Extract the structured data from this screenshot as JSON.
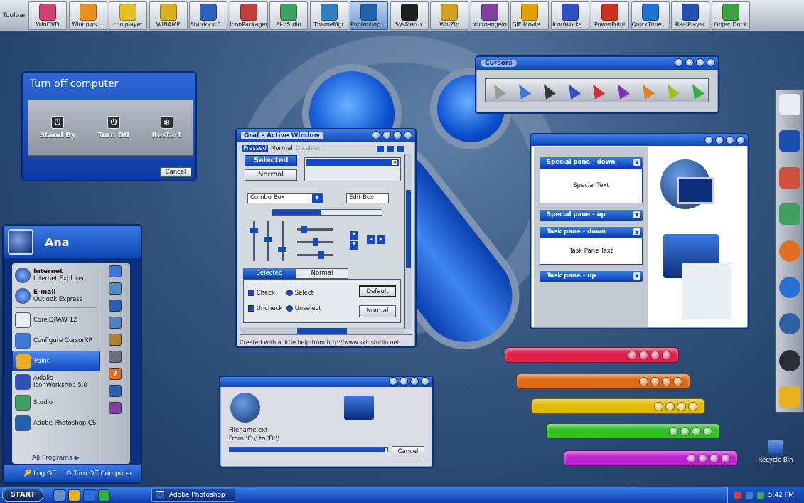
{
  "toolbar": {
    "label": "Toolbar",
    "items": [
      {
        "label": "WinDVD",
        "color": "#d04070"
      },
      {
        "label": "Windows ...",
        "color": "#e89020"
      },
      {
        "label": "coolplayer",
        "color": "#e8c020"
      },
      {
        "label": "WINAMP",
        "color": "#d8b020"
      },
      {
        "label": "Stardock C...",
        "color": "#3060c0"
      },
      {
        "label": "IconPackager",
        "color": "#c04040"
      },
      {
        "label": "SknStdio",
        "color": "#40a060"
      },
      {
        "label": "ThemeMgr",
        "color": "#3080c0"
      },
      {
        "label": "Photoshop ...",
        "color": "#2060b0"
      },
      {
        "label": "SysMetrix",
        "color": "#202020"
      },
      {
        "label": "WinZip",
        "color": "#d0a020"
      },
      {
        "label": "Microangelo",
        "color": "#8040a0"
      },
      {
        "label": "GIF Movie ...",
        "color": "#e0a000"
      },
      {
        "label": "IconWorks...",
        "color": "#3050c0"
      },
      {
        "label": "PowerPoint",
        "color": "#d03020"
      },
      {
        "label": "QuickTime ...",
        "color": "#2070d0"
      },
      {
        "label": "RealPlayer",
        "color": "#2050b0"
      },
      {
        "label": "ObjectDock",
        "color": "#40a040"
      }
    ],
    "active_index": 8
  },
  "turnoff": {
    "title": "Turn off computer",
    "standby": "Stand By",
    "turnoff": "Turn Off",
    "restart": "Restart",
    "cancel": "Cancel"
  },
  "startmenu": {
    "user": "Ana",
    "internet_title": "Internet",
    "internet_sub": "Internet Explorer",
    "email_title": "E-mail",
    "email_sub": "Outlook Express",
    "items": [
      "CorelDRAW 12",
      "Configure CursorXP",
      "Paint",
      "Axialis IconWorkshop 5.0",
      "Studio",
      "Adobe Photoshop CS"
    ],
    "all_programs": "All Programs",
    "log_off": "Log Off",
    "turn_off": "Turn Off Computer"
  },
  "graf": {
    "title": "Graf - Active Window",
    "tab_pressed": "Pressed",
    "tab_normal": "Normal",
    "tab_disabled": "Disabled",
    "btn_selected": "Selected",
    "btn_normal": "Normal",
    "combo": "Combo Box",
    "edit": "Edit Box",
    "tab2_selected": "Selected",
    "tab2_normal": "Normal",
    "check": "Check",
    "uncheck": "Uncheck",
    "select": "Select",
    "unselect": "Unselect",
    "default_btn": "Default",
    "normal_btn": "Normal",
    "progress": 0.45,
    "status": "Created with a little help from http://www.skinstudio.net"
  },
  "cursors": {
    "title": "Cursors",
    "colors": [
      "#9a9a9a",
      "#3b78d8",
      "#333333",
      "#3050c8",
      "#d03030",
      "#8030c0",
      "#e08020",
      "#a0c020",
      "#30b040"
    ]
  },
  "taskpane": {
    "special_down": "Special pane - down",
    "special_text": "Special Text",
    "special_up": "Special pane - up",
    "task_down": "Task pane - down",
    "task_text": "Task Pane Text",
    "task_up": "Task pane - up"
  },
  "copy": {
    "filename": "Filename.ext",
    "from_to": "From 'C:\\' to 'D:\\'",
    "cancel": "Cancel",
    "progress": 0.98
  },
  "bars": [
    {
      "color": "#e0204a"
    },
    {
      "color": "#e06a10"
    },
    {
      "color": "#e0b800"
    },
    {
      "color": "#30c020"
    },
    {
      "color": "#c020d0"
    }
  ],
  "desktop": {
    "recycle_bin": "Recycle Bin"
  },
  "taskbar": {
    "start": "START",
    "task": "Adobe Photoshop",
    "clock": "5:42 PM"
  }
}
